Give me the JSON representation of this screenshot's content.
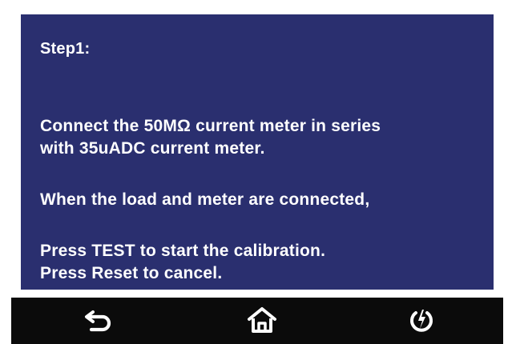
{
  "screen": {
    "step_title": "Step1:",
    "lines": [
      "Connect the 50MΩ current meter in series",
      "with 35uADC current meter.",
      "When the load and meter are connected,",
      "Press TEST to start the calibration.",
      "Press Reset to cancel."
    ]
  },
  "nav": {
    "icons": [
      "back-arrow-icon",
      "home-icon",
      "power-icon"
    ]
  },
  "colors": {
    "screen_bg": "#2a2f6f",
    "text": "#ffffff",
    "bezel": "#0b0b0b"
  }
}
